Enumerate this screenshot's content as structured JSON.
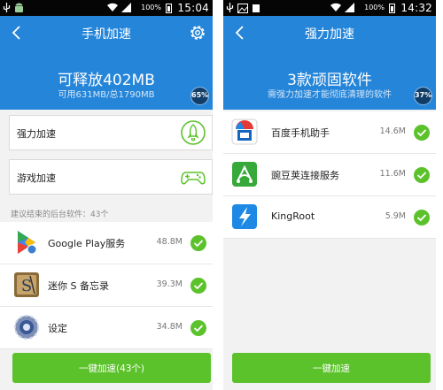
{
  "status_left": {
    "battery_pct": "100%",
    "time": "15:04"
  },
  "status_right": {
    "battery_pct": "100%",
    "time": "14:32"
  },
  "left": {
    "title": "手机加速",
    "release": "可释放402MB",
    "memory": "可用631MB/总1790MB",
    "badge": "65%",
    "cards": [
      {
        "label": "强力加速",
        "icon": "rocket-icon"
      },
      {
        "label": "游戏加速",
        "icon": "gamepad-icon"
      }
    ],
    "section_note": "建议结束的后台软件：43个",
    "apps": [
      {
        "name": "Google Play服务",
        "size": "48.8M",
        "icon": "google-play-services-icon"
      },
      {
        "name": "迷你 S 备忘录",
        "size": "39.3M",
        "icon": "mini-s-memo-icon"
      },
      {
        "name": "设定",
        "size": "34.8M",
        "icon": "settings-gear-icon"
      }
    ],
    "button": "一键加速(43个)"
  },
  "right": {
    "title": "强力加速",
    "headline": "3款顽固软件",
    "subline": "需强力加速才能彻底清理的软件",
    "badge": "37%",
    "apps": [
      {
        "name": "百度手机助手",
        "size": "14.6M",
        "icon": "baidu-assistant-icon"
      },
      {
        "name": "豌豆荚连接服务",
        "size": "11.6M",
        "icon": "wandoujia-icon"
      },
      {
        "name": "KingRoot",
        "size": "5.9M",
        "icon": "kingroot-icon"
      }
    ],
    "button": "一键加速"
  },
  "colors": {
    "header_blue": "#2585d9",
    "accent_green": "#5cc22c",
    "status_bar": "#050505"
  }
}
